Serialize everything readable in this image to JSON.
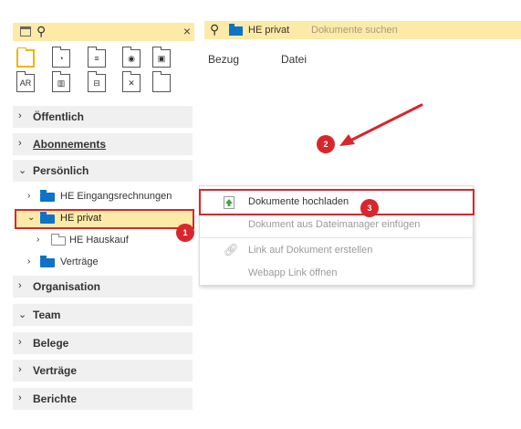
{
  "left_pane": {
    "search": {
      "close_label": "×"
    },
    "tiles": [
      "",
      "◔",
      "≡",
      "◉",
      "▣",
      "AR",
      "▥",
      "⊟",
      "✕",
      ""
    ],
    "sections": [
      {
        "label": "Öffentlich",
        "chev": "›"
      },
      {
        "label": "Abonnements",
        "chev": "›"
      },
      {
        "label": "Persönlich",
        "chev": "⌄"
      },
      {
        "label": "Organisation",
        "chev": "›"
      },
      {
        "label": "Team",
        "chev": "⌄"
      },
      {
        "label": "Belege",
        "chev": "›"
      },
      {
        "label": "Verträge",
        "chev": "›"
      },
      {
        "label": "Berichte",
        "chev": "›"
      }
    ],
    "tree": [
      {
        "label": "HE Eingangsrechnungen",
        "chev": "›"
      },
      {
        "label": "HE privat",
        "chev": "⌄"
      },
      {
        "label": "HE Hauskauf",
        "chev": "›"
      },
      {
        "label": "Verträge",
        "chev": "›"
      }
    ]
  },
  "right_pane": {
    "search": {
      "context": "HE privat",
      "placeholder": "Dokumente suchen"
    },
    "columns": [
      "Bezug",
      "Datei"
    ]
  },
  "context_menu": {
    "items": [
      {
        "label": "Dokumente hochladen",
        "icon": "upload-icon",
        "enabled": true
      },
      {
        "label": "Dokument aus Dateimanager einfügen",
        "icon": "",
        "enabled": false
      },
      {
        "label": "Link auf Dokument erstellen",
        "icon": "link-icon",
        "enabled": false
      },
      {
        "label": "Webapp Link öffnen",
        "icon": "",
        "enabled": false
      }
    ]
  },
  "annotations": {
    "badge1": "1",
    "badge2": "2",
    "badge3": "3"
  },
  "colors": {
    "highlight": "#fdeaa6",
    "annotation_red": "#d9262c",
    "folder_blue": "#0d73c7"
  }
}
